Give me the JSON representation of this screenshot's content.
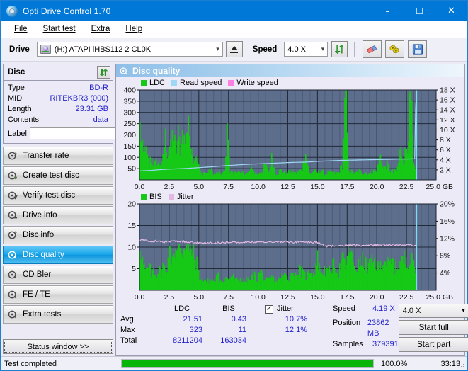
{
  "window": {
    "title": "Opti Drive Control 1.70",
    "icon": "disc-icon",
    "minimize": "–",
    "maximize": "☐",
    "close": "✕"
  },
  "menu": {
    "items": [
      "File",
      "Start test",
      "Extra",
      "Help"
    ]
  },
  "toolbar": {
    "drive_label": "Drive",
    "drive_value": "(H:)  ATAPI iHBS112  2 CL0K",
    "eject_title": "eject-icon",
    "speed_label": "Speed",
    "speed_value": "4.0 X",
    "icons": [
      "refresh-icon",
      "eraser-icon",
      "settings-icon",
      "save-icon"
    ]
  },
  "disc": {
    "title": "Disc",
    "refresh_icon": "refresh-icon",
    "rows": [
      {
        "key": "Type",
        "value": "BD-R"
      },
      {
        "key": "MID",
        "value": "RITEKBR3 (000)"
      },
      {
        "key": "Length",
        "value": "23.31 GB"
      },
      {
        "key": "Contents",
        "value": "data"
      }
    ],
    "label_key": "Label",
    "label_value": "",
    "label_placeholder": "",
    "cd_icon": "cd-icon"
  },
  "sidebar": {
    "items": [
      {
        "label": "Transfer rate",
        "active": false
      },
      {
        "label": "Create test disc",
        "active": false
      },
      {
        "label": "Verify test disc",
        "active": false
      },
      {
        "label": "Drive info",
        "active": false
      },
      {
        "label": "Disc info",
        "active": false
      },
      {
        "label": "Disc quality",
        "active": true
      },
      {
        "label": "CD Bler",
        "active": false
      },
      {
        "label": "FE / TE",
        "active": false
      },
      {
        "label": "Extra tests",
        "active": false
      }
    ],
    "status_button": "Status window >>"
  },
  "main": {
    "header_title": "Disc quality",
    "header_icon": "disc-quality-icon"
  },
  "stats": {
    "col_ldc": "LDC",
    "col_bis": "BIS",
    "row_avg": "Avg",
    "row_max": "Max",
    "row_total": "Total",
    "ldc_avg": "21.51",
    "ldc_max": "323",
    "ldc_total": "8211204",
    "bis_avg": "0.43",
    "bis_max": "11",
    "bis_total": "163034",
    "jitter_label": "Jitter",
    "jitter_checked": "✓",
    "jitter_avg": "10.7%",
    "jitter_max": "12.1%",
    "speed_key": "Speed",
    "speed_value": "4.19 X",
    "position_key": "Position",
    "position_value": "23862 MB",
    "samples_key": "Samples",
    "samples_value": "379391",
    "speed_select": "4.0 X",
    "start_full": "Start full",
    "start_part": "Start part"
  },
  "statusbar": {
    "message": "Test completed",
    "percent": "100.0%",
    "progress": 100,
    "elapsed": "33:13"
  },
  "colors": {
    "accent": "#0078d7",
    "ldc_green": "#16c916",
    "read_speed": "#9fd8f5",
    "write_speed": "#ff7fe0",
    "jitter_pink": "#e3b9e3",
    "plot_bg": "#5d6d8c",
    "value_blue": "#2222cc",
    "progress_green": "#0ab50a"
  },
  "chart_data": [
    {
      "type": "area",
      "name": "top-chart",
      "title": "Disc quality",
      "xlabel": "GB",
      "ylabel": "LDC",
      "xlim": [
        0,
        25
      ],
      "ylim": [
        0,
        400
      ],
      "y2lim": [
        0,
        18
      ],
      "y2label": "X",
      "grid": true,
      "xticks": [
        0.0,
        2.5,
        5.0,
        7.5,
        10.0,
        12.5,
        15.0,
        17.5,
        20.0,
        22.5,
        25.0
      ],
      "xticklabels": [
        "0.0",
        "2.5",
        "5.0",
        "7.5",
        "10.0",
        "12.5",
        "15.0",
        "17.5",
        "20.0",
        "22.5",
        "25.0 GB"
      ],
      "yticks": [
        50,
        100,
        150,
        200,
        250,
        300,
        350,
        400
      ],
      "y2ticks": [
        2,
        4,
        6,
        8,
        10,
        12,
        14,
        16,
        18
      ],
      "y2ticklabels": [
        "2 X",
        "4 X",
        "6 X",
        "8 X",
        "10 X",
        "12 X",
        "14 X",
        "16 X",
        "18 X"
      ],
      "legend": [
        {
          "label": "LDC",
          "color": "#16c916"
        },
        {
          "label": "Read speed",
          "color": "#9fd8f5"
        },
        {
          "label": "Write speed",
          "color": "#ff7fe0"
        }
      ],
      "legend_position": "top-left",
      "series": [
        {
          "name": "LDC",
          "color": "#16c916",
          "x": [
            0.05,
            0.15,
            0.25,
            0.35,
            0.45,
            0.55,
            0.7,
            0.85,
            1.0,
            1.15,
            1.3,
            1.45,
            1.6,
            1.75,
            1.9,
            2.05,
            2.2,
            2.35,
            2.5,
            2.65,
            2.8,
            2.95,
            3.1,
            3.25,
            3.4,
            3.55,
            3.7,
            3.85,
            4.0,
            4.15,
            4.3,
            4.45,
            4.6,
            4.75,
            4.9,
            5.0,
            5.15,
            5.4,
            5.7,
            6.0,
            6.3,
            6.6,
            6.9,
            7.2,
            7.5,
            7.6,
            7.9,
            8.2,
            8.5,
            8.8,
            9.1,
            9.4,
            9.7,
            10.0,
            10.3,
            10.6,
            10.9,
            11.2,
            11.4,
            11.6,
            11.9,
            12.2,
            12.5,
            12.8,
            13.1,
            13.4,
            13.7,
            14.0,
            14.3,
            14.4,
            14.7,
            15.0,
            15.3,
            15.6,
            15.9,
            16.2,
            16.5,
            16.8,
            17.1,
            17.35,
            17.45,
            17.6,
            17.9,
            18.2,
            18.5,
            18.8,
            19.1,
            19.4,
            19.7,
            20.0,
            20.3,
            20.6,
            20.8,
            21.1,
            21.4,
            21.7,
            22.0,
            22.3,
            22.45,
            22.6,
            22.8,
            22.95,
            23.1,
            23.3
          ],
          "y": [
            210,
            150,
            120,
            95,
            155,
            100,
            80,
            70,
            90,
            65,
            60,
            75,
            62,
            70,
            58,
            110,
            175,
            95,
            140,
            120,
            190,
            150,
            115,
            180,
            130,
            200,
            150,
            175,
            205,
            195,
            160,
            120,
            90,
            100,
            75,
            60,
            22,
            30,
            25,
            40,
            20,
            28,
            22,
            35,
            230,
            30,
            25,
            40,
            22,
            30,
            25,
            45,
            28,
            22,
            35,
            60,
            28,
            100,
            32,
            25,
            40,
            30,
            28,
            35,
            25,
            30,
            45,
            105,
            30,
            25,
            35,
            28,
            40,
            22,
            30,
            28,
            25,
            30,
            60,
            320,
            290,
            45,
            30,
            25,
            35,
            28,
            30,
            25,
            35,
            30,
            95,
            35,
            65,
            40,
            30,
            35,
            120,
            80,
            120,
            160,
            300,
            250,
            60,
            25
          ]
        },
        {
          "name": "Read speed",
          "color": "#9fd8f5",
          "unit": "X",
          "x": [
            0.0,
            1.0,
            2.0,
            3.0,
            4.0,
            5.0,
            6.0,
            7.0,
            8.0,
            9.0,
            10.0,
            11.0,
            12.0,
            13.0,
            14.0,
            15.0,
            16.0,
            17.0,
            18.0,
            19.0,
            20.0,
            21.0,
            22.0,
            23.2,
            23.3
          ],
          "y": [
            1.8,
            1.9,
            2.1,
            2.2,
            2.3,
            2.45,
            2.6,
            2.8,
            2.95,
            3.1,
            3.2,
            3.3,
            3.4,
            3.5,
            3.55,
            3.7,
            3.8,
            3.9,
            3.95,
            4.0,
            4.05,
            4.1,
            4.15,
            4.2,
            18.0
          ]
        },
        {
          "name": "Write speed",
          "color": "#ff7fe0",
          "x": [],
          "y": []
        }
      ]
    },
    {
      "type": "area",
      "name": "bottom-chart",
      "xlabel": "GB",
      "ylabel": "BIS",
      "xlim": [
        0,
        25
      ],
      "ylim": [
        0,
        20
      ],
      "y2lim": [
        0,
        20
      ],
      "y2label": "%",
      "grid": true,
      "xticks": [
        0.0,
        2.5,
        5.0,
        7.5,
        10.0,
        12.5,
        15.0,
        17.5,
        20.0,
        22.5,
        25.0
      ],
      "xticklabels": [
        "0.0",
        "2.5",
        "5.0",
        "7.5",
        "10.0",
        "12.5",
        "15.0",
        "17.5",
        "20.0",
        "22.5",
        "25.0 GB"
      ],
      "yticks": [
        5,
        10,
        15,
        20
      ],
      "y2ticks": [
        4,
        8,
        12,
        16,
        20
      ],
      "y2ticklabels": [
        "4%",
        "8%",
        "12%",
        "16%",
        "20%"
      ],
      "legend": [
        {
          "label": "BIS",
          "color": "#16c916"
        },
        {
          "label": "Jitter",
          "color": "#e3b9e3"
        }
      ],
      "legend_position": "top-left",
      "series": [
        {
          "name": "BIS",
          "color": "#16c916",
          "x": [
            0.05,
            0.15,
            0.3,
            0.45,
            0.6,
            0.8,
            1.0,
            1.2,
            1.4,
            1.6,
            1.8,
            2.0,
            2.2,
            2.4,
            2.6,
            2.8,
            3.0,
            3.2,
            3.4,
            3.6,
            3.8,
            4.0,
            4.2,
            4.4,
            4.6,
            4.8,
            4.95,
            5.1,
            5.4,
            5.7,
            6.0,
            6.3,
            6.6,
            6.9,
            7.2,
            7.5,
            7.8,
            8.1,
            8.4,
            8.7,
            9.0,
            9.3,
            9.6,
            9.9,
            10.2,
            10.5,
            10.8,
            11.1,
            11.4,
            11.7,
            12.0,
            12.3,
            12.6,
            12.9,
            13.2,
            13.5,
            13.8,
            14.1,
            14.4,
            14.7,
            15.0,
            15.3,
            15.6,
            15.9,
            16.2,
            16.5,
            16.8,
            17.1,
            17.4,
            17.7,
            18.0,
            18.3,
            18.6,
            18.9,
            19.2,
            19.5,
            19.8,
            20.1,
            20.4,
            20.7,
            21.0,
            21.3,
            21.6,
            21.9,
            22.2,
            22.5,
            22.8,
            23.1,
            23.3
          ],
          "y": [
            9.6,
            7.5,
            5.5,
            4.2,
            3.5,
            5.0,
            3.2,
            4.8,
            3.0,
            4.4,
            3.6,
            5.2,
            4.0,
            6.2,
            7.8,
            6.5,
            8.8,
            7.2,
            9.2,
            8.0,
            10.3,
            9.0,
            7.6,
            8.4,
            6.8,
            5.6,
            5.0,
            2.0,
            2.4,
            1.8,
            2.2,
            2.0,
            3.0,
            1.9,
            2.6,
            2.1,
            3.2,
            2.0,
            2.4,
            1.8,
            2.2,
            2.0,
            3.4,
            2.2,
            4.0,
            2.2,
            2.0,
            2.6,
            2.2,
            2.0,
            2.8,
            3.2,
            2.4,
            3.6,
            2.8,
            4.2,
            3.4,
            2.8,
            4.6,
            3.2,
            6.6,
            3.8,
            4.2,
            3.4,
            4.8,
            5.2,
            3.8,
            6.4,
            5.0,
            9.0,
            5.6,
            4.4,
            5.8,
            6.2,
            4.8,
            5.4,
            6.0,
            4.6,
            5.2,
            6.6,
            5.0,
            5.8,
            4.6,
            5.4,
            6.2,
            7.0,
            5.6,
            6.0,
            4.2
          ]
        },
        {
          "name": "Jitter",
          "color": "#e3b9e3",
          "unit": "%",
          "x": [
            0.0,
            0.5,
            1.0,
            1.5,
            2.0,
            2.5,
            3.0,
            3.5,
            4.0,
            4.5,
            5.0,
            5.5,
            6.0,
            6.5,
            7.0,
            7.5,
            8.0,
            8.5,
            9.0,
            9.5,
            10.0,
            10.5,
            11.0,
            11.5,
            12.0,
            12.5,
            13.0,
            13.5,
            14.0,
            14.5,
            15.0,
            15.3,
            15.6,
            16.0,
            16.5,
            17.0,
            17.5,
            18.0,
            18.5,
            19.0,
            19.5,
            20.0,
            20.5,
            21.0,
            21.5,
            22.0,
            22.5,
            23.0,
            23.3
          ],
          "y": [
            11.6,
            11.5,
            11.4,
            11.3,
            11.2,
            11.3,
            11.3,
            11.25,
            11.2,
            11.1,
            11.05,
            11.0,
            10.95,
            11.0,
            11.05,
            11.1,
            11.15,
            11.1,
            11.2,
            11.15,
            11.1,
            11.2,
            11.15,
            11.2,
            11.25,
            11.2,
            11.15,
            11.2,
            11.15,
            11.1,
            11.0,
            10.6,
            10.3,
            10.2,
            10.25,
            10.3,
            10.35,
            10.4,
            10.35,
            10.4,
            10.45,
            10.4,
            10.5,
            10.45,
            10.5,
            10.45,
            10.5,
            10.4,
            10.3
          ]
        }
      ]
    }
  ]
}
